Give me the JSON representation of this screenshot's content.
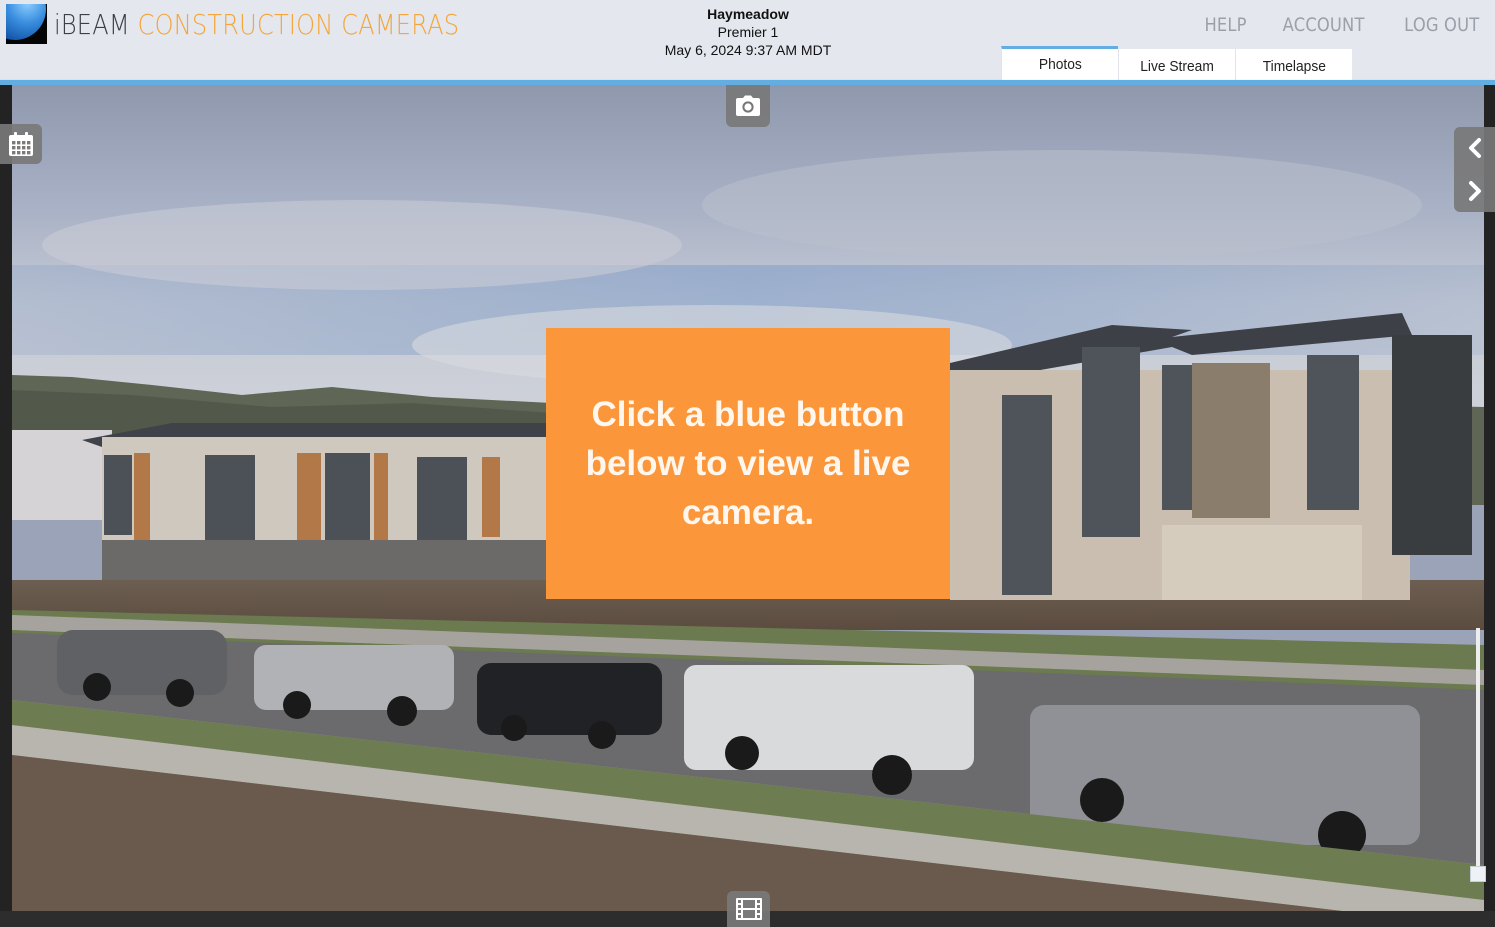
{
  "header": {
    "brand_primary": "iBEAM",
    "brand_secondary": "CONSTRUCTION CAMERAS",
    "site_name": "Haymeadow",
    "camera_name": "Premier 1",
    "timestamp": "May 6, 2024 9:37 AM MDT",
    "links": [
      {
        "label": "HELP"
      },
      {
        "label": "ACCOUNT"
      },
      {
        "label": "LOG OUT"
      }
    ],
    "tabs": [
      {
        "label": "Photos",
        "active": true
      },
      {
        "label": "Live Stream",
        "active": false
      },
      {
        "label": "Timelapse",
        "active": false
      }
    ]
  },
  "viewer": {
    "image_description": "Construction site camera photo: multi-story apartment buildings under construction with mountains behind, parked cars and trucks on street in foreground",
    "overlay_message": "Click a blue button below to view a live camera.",
    "controls": {
      "camera_icon": "camera-icon",
      "calendar_icon": "calendar-icon",
      "film_icon": "film-icon",
      "prev_icon": "chevron-left-icon",
      "next_icon": "chevron-right-icon"
    }
  },
  "colors": {
    "accent_blue": "#62aee3",
    "brand_orange": "#f5a53a",
    "overlay_orange": "#fb963a",
    "header_bg": "#e4e7ee"
  }
}
